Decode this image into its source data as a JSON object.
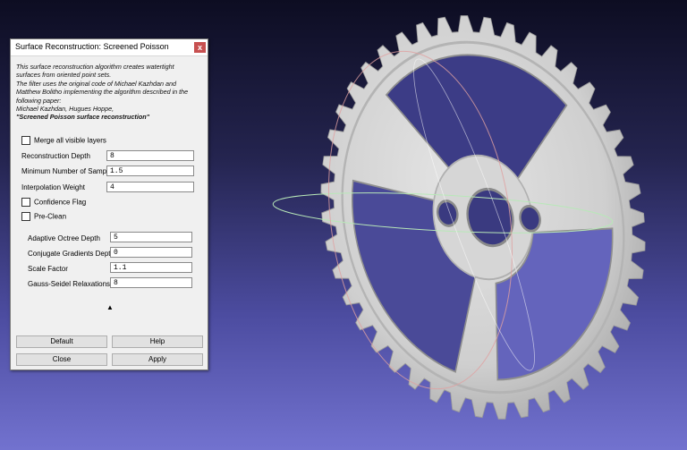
{
  "dialog": {
    "title": "Surface Reconstruction: Screened Poisson",
    "close_label": "x",
    "description_lines": [
      "This surface reconstruction algorithm creates watertight",
      "surfaces from oriented point sets.",
      "The filter uses the original code of Michael Kazhdan and",
      "Matthew Bolitho implementing the algorithm described in the",
      "following paper:",
      "Michael Kazhdan, Hugues Hoppe,"
    ],
    "paper_title": "\"Screened Poisson surface reconstruction\"",
    "merge_layers_label": "Merge all visible layers",
    "params": [
      {
        "label": "Reconstruction Depth",
        "value": "8"
      },
      {
        "label": "Minimum Number of Samples",
        "value": "1.5"
      },
      {
        "label": "Interpolation Weight",
        "value": "4"
      }
    ],
    "confidence_label": "Confidence Flag",
    "preclean_label": "Pre-Clean",
    "advanced": [
      {
        "label": "Adaptive Octree Depth",
        "value": "5"
      },
      {
        "label": "Conjugate Gradients Depth",
        "value": "0"
      },
      {
        "label": "Scale Factor",
        "value": "1.1"
      },
      {
        "label": "Gauss-Seidel Relaxations",
        "value": "8"
      }
    ],
    "collapse_arrow": "▲",
    "buttons": {
      "default": "Default",
      "help": "Help",
      "close": "Close",
      "apply": "Apply"
    }
  },
  "viewport": {
    "background_top": "#0d0d22",
    "background_bottom": "#7272cf",
    "gear_color": "#d2d2d2",
    "gear_teeth": 44,
    "trackball_colors": [
      "#b8e8b8",
      "#e0a0a0",
      "#ffffff"
    ]
  }
}
